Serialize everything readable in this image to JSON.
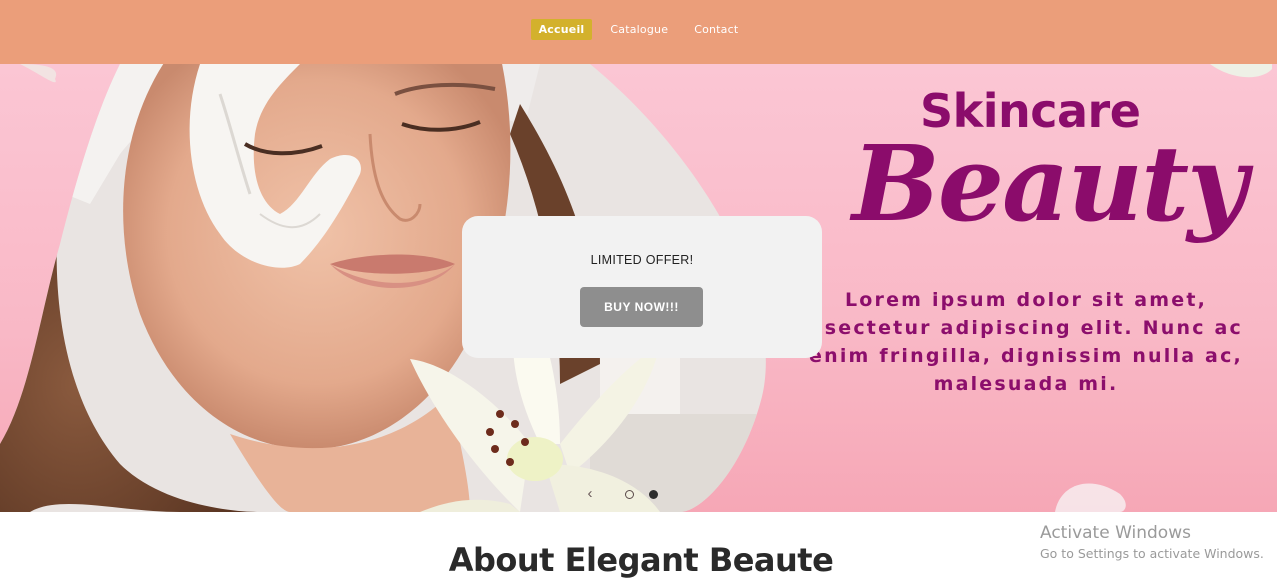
{
  "nav": {
    "items": [
      {
        "label": "Accueil",
        "active": true
      },
      {
        "label": "Catalogue",
        "active": false
      },
      {
        "label": "Contact",
        "active": false
      }
    ]
  },
  "hero": {
    "title_top": "Skincare",
    "title_main": "Beauty",
    "description_lines": [
      "Lorem ipsum dolor sit amet,",
      "nsectetur adipiscing elit. Nunc ac",
      "enim fringilla, dignissim nulla ac,",
      "malesuada mi."
    ],
    "image_icon": "woman-face-mask-photo",
    "flower_icon": "white-lily-flower"
  },
  "offer": {
    "text": "LIMITED OFFER!",
    "button_label": "BUY NOW!!!"
  },
  "carousel": {
    "prev_icon": "chevron-left-icon",
    "slide_count": 2,
    "active_slide": 2
  },
  "about": {
    "title": "About Elegant Beaute"
  },
  "watermark": {
    "title": "Activate Windows",
    "subtitle": "Go to Settings to activate Windows."
  },
  "colors": {
    "nav_background": "#eb9e7a",
    "nav_active": "#d3b12c",
    "hero_pink": "#fbc6d4",
    "brand_purple": "#8b0c6b",
    "offer_card": "#f2f2f2",
    "offer_button": "#8e8e8e"
  }
}
